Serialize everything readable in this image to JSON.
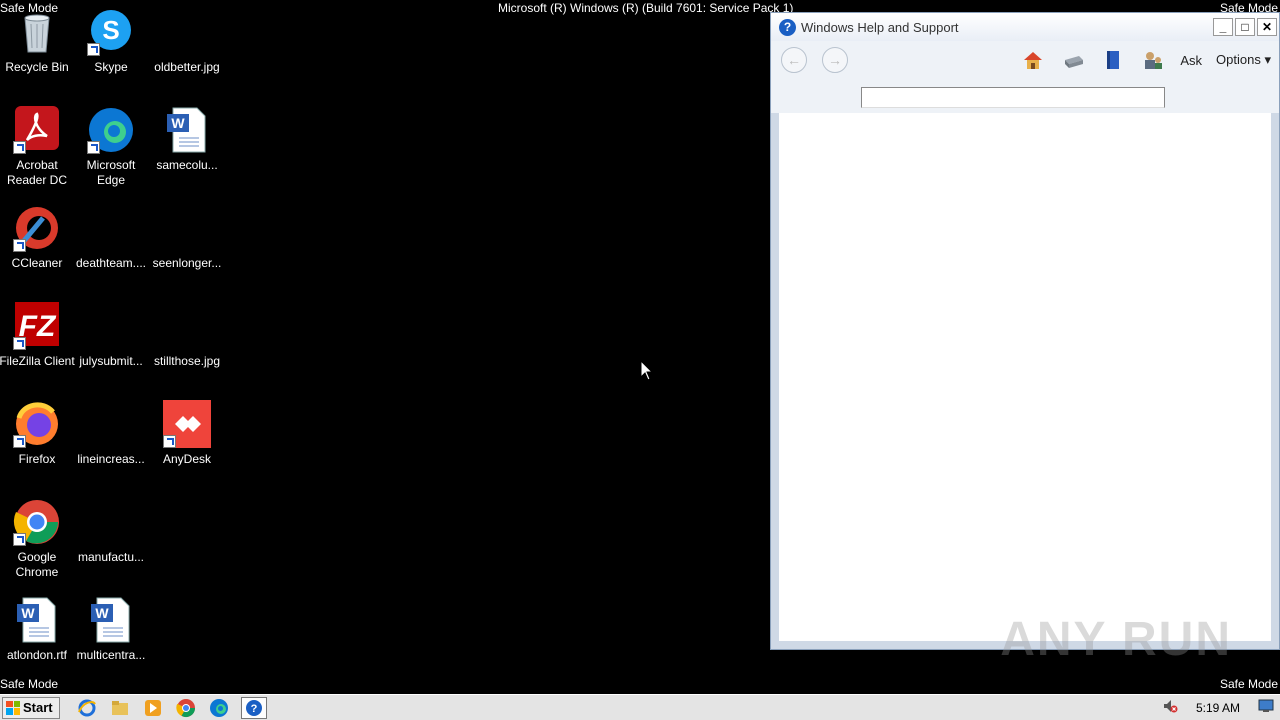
{
  "safe_mode": {
    "label": "Safe Mode"
  },
  "os_build": "Microsoft (R) Windows (R) (Build 7601: Service Pack 1)",
  "desktop_icons": [
    {
      "label": "Recycle Bin",
      "icon": "recycle-bin-icon"
    },
    {
      "label": "Skype",
      "icon": "skype-icon"
    },
    {
      "label": "oldbetter.jpg",
      "icon": "image-file-icon"
    },
    {
      "label": "Acrobat Reader DC",
      "icon": "acrobat-icon"
    },
    {
      "label": "Microsoft Edge",
      "icon": "edge-icon"
    },
    {
      "label": "samecolu...",
      "icon": "word-doc-icon"
    },
    {
      "label": "CCleaner",
      "icon": "ccleaner-icon"
    },
    {
      "label": "deathteam....",
      "icon": "blank-file-icon"
    },
    {
      "label": "seenlonger...",
      "icon": "blank-file-icon"
    },
    {
      "label": "FileZilla Client",
      "icon": "filezilla-icon"
    },
    {
      "label": "julysubmit...",
      "icon": "blank-file-icon"
    },
    {
      "label": "stillthose.jpg",
      "icon": "image-file-icon"
    },
    {
      "label": "Firefox",
      "icon": "firefox-icon"
    },
    {
      "label": "lineincreas...",
      "icon": "blank-file-icon"
    },
    {
      "label": "AnyDesk",
      "icon": "anydesk-icon"
    },
    {
      "label": "Google Chrome",
      "icon": "chrome-icon"
    },
    {
      "label": "manufactu...",
      "icon": "blank-file-icon"
    },
    {
      "label": "atlondon.rtf",
      "icon": "word-doc-icon"
    },
    {
      "label": "multicentra...",
      "icon": "word-doc-icon"
    }
  ],
  "help_window": {
    "title": "Windows Help and Support",
    "toolbar": {
      "ask_label": "Ask",
      "options_label": "Options"
    },
    "search_value": ""
  },
  "taskbar": {
    "start_label": "Start",
    "clock": "5:19 AM",
    "pinned": [
      "internet-explorer-icon",
      "explorer-folder-icon",
      "media-player-icon",
      "chrome-icon",
      "edge-icon",
      "help-icon"
    ]
  },
  "watermark": "ANY RUN"
}
